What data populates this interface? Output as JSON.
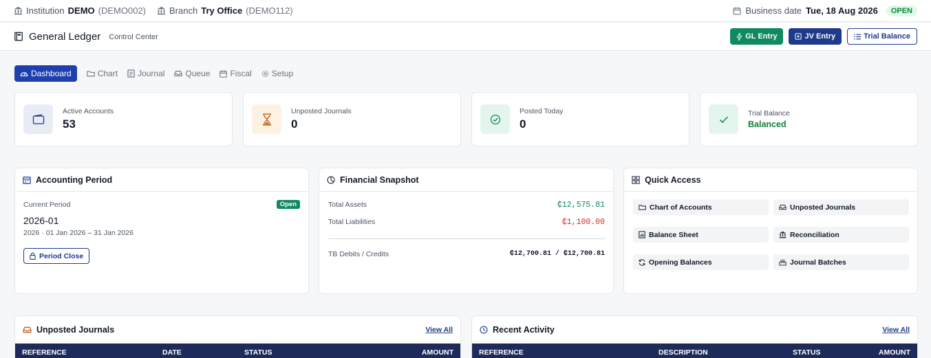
{
  "topbar": {
    "institution_label": "Institution",
    "institution_code": "DEMO",
    "institution_id": "(DEMO002)",
    "branch_label": "Branch",
    "branch_name": "Try Office",
    "branch_id": "(DEMO112)",
    "business_date_label": "Business date",
    "business_date": "Tue, 18 Aug 2026",
    "status": "OPEN"
  },
  "header": {
    "title": "General Ledger",
    "subtitle": "Control Center",
    "gl_entry": "GL Entry",
    "jv_entry": "JV Entry",
    "trial_balance": "Trial Balance"
  },
  "tabs": [
    {
      "label": "Dashboard",
      "icon": "gauge-icon"
    },
    {
      "label": "Chart",
      "icon": "folder-icon"
    },
    {
      "label": "Journal",
      "icon": "journal-icon"
    },
    {
      "label": "Queue",
      "icon": "inbox-icon"
    },
    {
      "label": "Fiscal",
      "icon": "calendar-icon"
    },
    {
      "label": "Setup",
      "icon": "gear-icon"
    }
  ],
  "kpis": [
    {
      "label": "Active Accounts",
      "value": "53"
    },
    {
      "label": "Unposted Journals",
      "value": "0"
    },
    {
      "label": "Posted Today",
      "value": "0"
    },
    {
      "label": "Trial Balance",
      "value": "Balanced"
    }
  ],
  "period": {
    "title": "Accounting Period",
    "current_label": "Current Period",
    "status": "Open",
    "period": "2026-01",
    "range": "2026 · 01 Jan 2026 – 31 Jan 2026",
    "close_button": "Period Close"
  },
  "snapshot": {
    "title": "Financial Snapshot",
    "assets_label": "Total Assets",
    "assets_value": "₵12,575.81",
    "liabilities_label": "Total Liabilities",
    "liabilities_value": "₵1,100.00",
    "tb_label": "TB Debits / Credits",
    "tb_value": "₵12,700.81 / ₵12,700.81"
  },
  "quick_access": {
    "title": "Quick Access",
    "items": [
      {
        "label": "Chart of Accounts",
        "icon": "folder-icon"
      },
      {
        "label": "Unposted Journals",
        "icon": "inbox-icon"
      },
      {
        "label": "Balance Sheet",
        "icon": "report-icon"
      },
      {
        "label": "Reconciliation",
        "icon": "bank-icon"
      },
      {
        "label": "Opening Balances",
        "icon": "refresh-icon"
      },
      {
        "label": "Journal Batches",
        "icon": "stack-icon"
      }
    ]
  },
  "unposted": {
    "title": "Unposted Journals",
    "view_all": "View All",
    "columns": [
      "REFERENCE",
      "DATE",
      "STATUS",
      "AMOUNT"
    ]
  },
  "recent": {
    "title": "Recent Activity",
    "view_all": "View All",
    "columns": [
      "REFERENCE",
      "DESCRIPTION",
      "STATUS",
      "AMOUNT"
    ]
  },
  "colors": {
    "navy": "#1e3a8a",
    "green": "#0f8a5f",
    "red": "#dc2626",
    "table_header": "#1e2a5a"
  }
}
